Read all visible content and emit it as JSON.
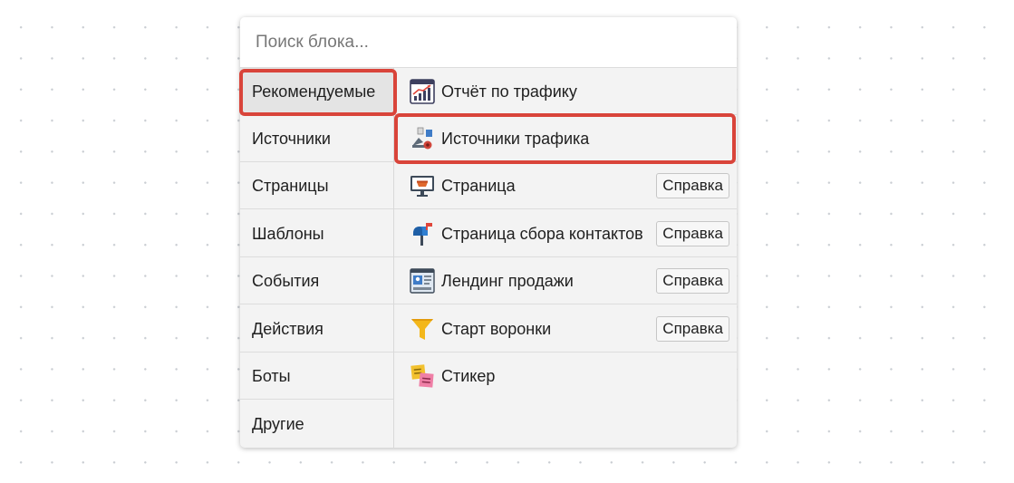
{
  "search": {
    "placeholder": "Поиск блока..."
  },
  "categories": [
    {
      "label": "Рекомендуемые",
      "active": true
    },
    {
      "label": "Источники"
    },
    {
      "label": "Страницы"
    },
    {
      "label": "Шаблоны"
    },
    {
      "label": "События"
    },
    {
      "label": "Действия"
    },
    {
      "label": "Боты"
    },
    {
      "label": "Другие"
    }
  ],
  "blocks": [
    {
      "label": "Отчёт по трафику",
      "icon": "chart-report-icon"
    },
    {
      "label": "Источники трафика",
      "icon": "traffic-sources-icon"
    },
    {
      "label": "Страница",
      "icon": "monitor-page-icon",
      "help": "Справка"
    },
    {
      "label": "Страница сбора контактов",
      "icon": "mailbox-icon",
      "help": "Справка"
    },
    {
      "label": "Лендинг продажи",
      "icon": "landing-page-icon",
      "help": "Справка"
    },
    {
      "label": "Старт воронки",
      "icon": "funnel-icon",
      "help": "Справка"
    },
    {
      "label": "Стикер",
      "icon": "sticky-notes-icon"
    }
  ],
  "colors": {
    "highlight": "#d9443a",
    "panel_bg": "#f3f3f3",
    "active_category_bg": "#e4e4e4"
  }
}
